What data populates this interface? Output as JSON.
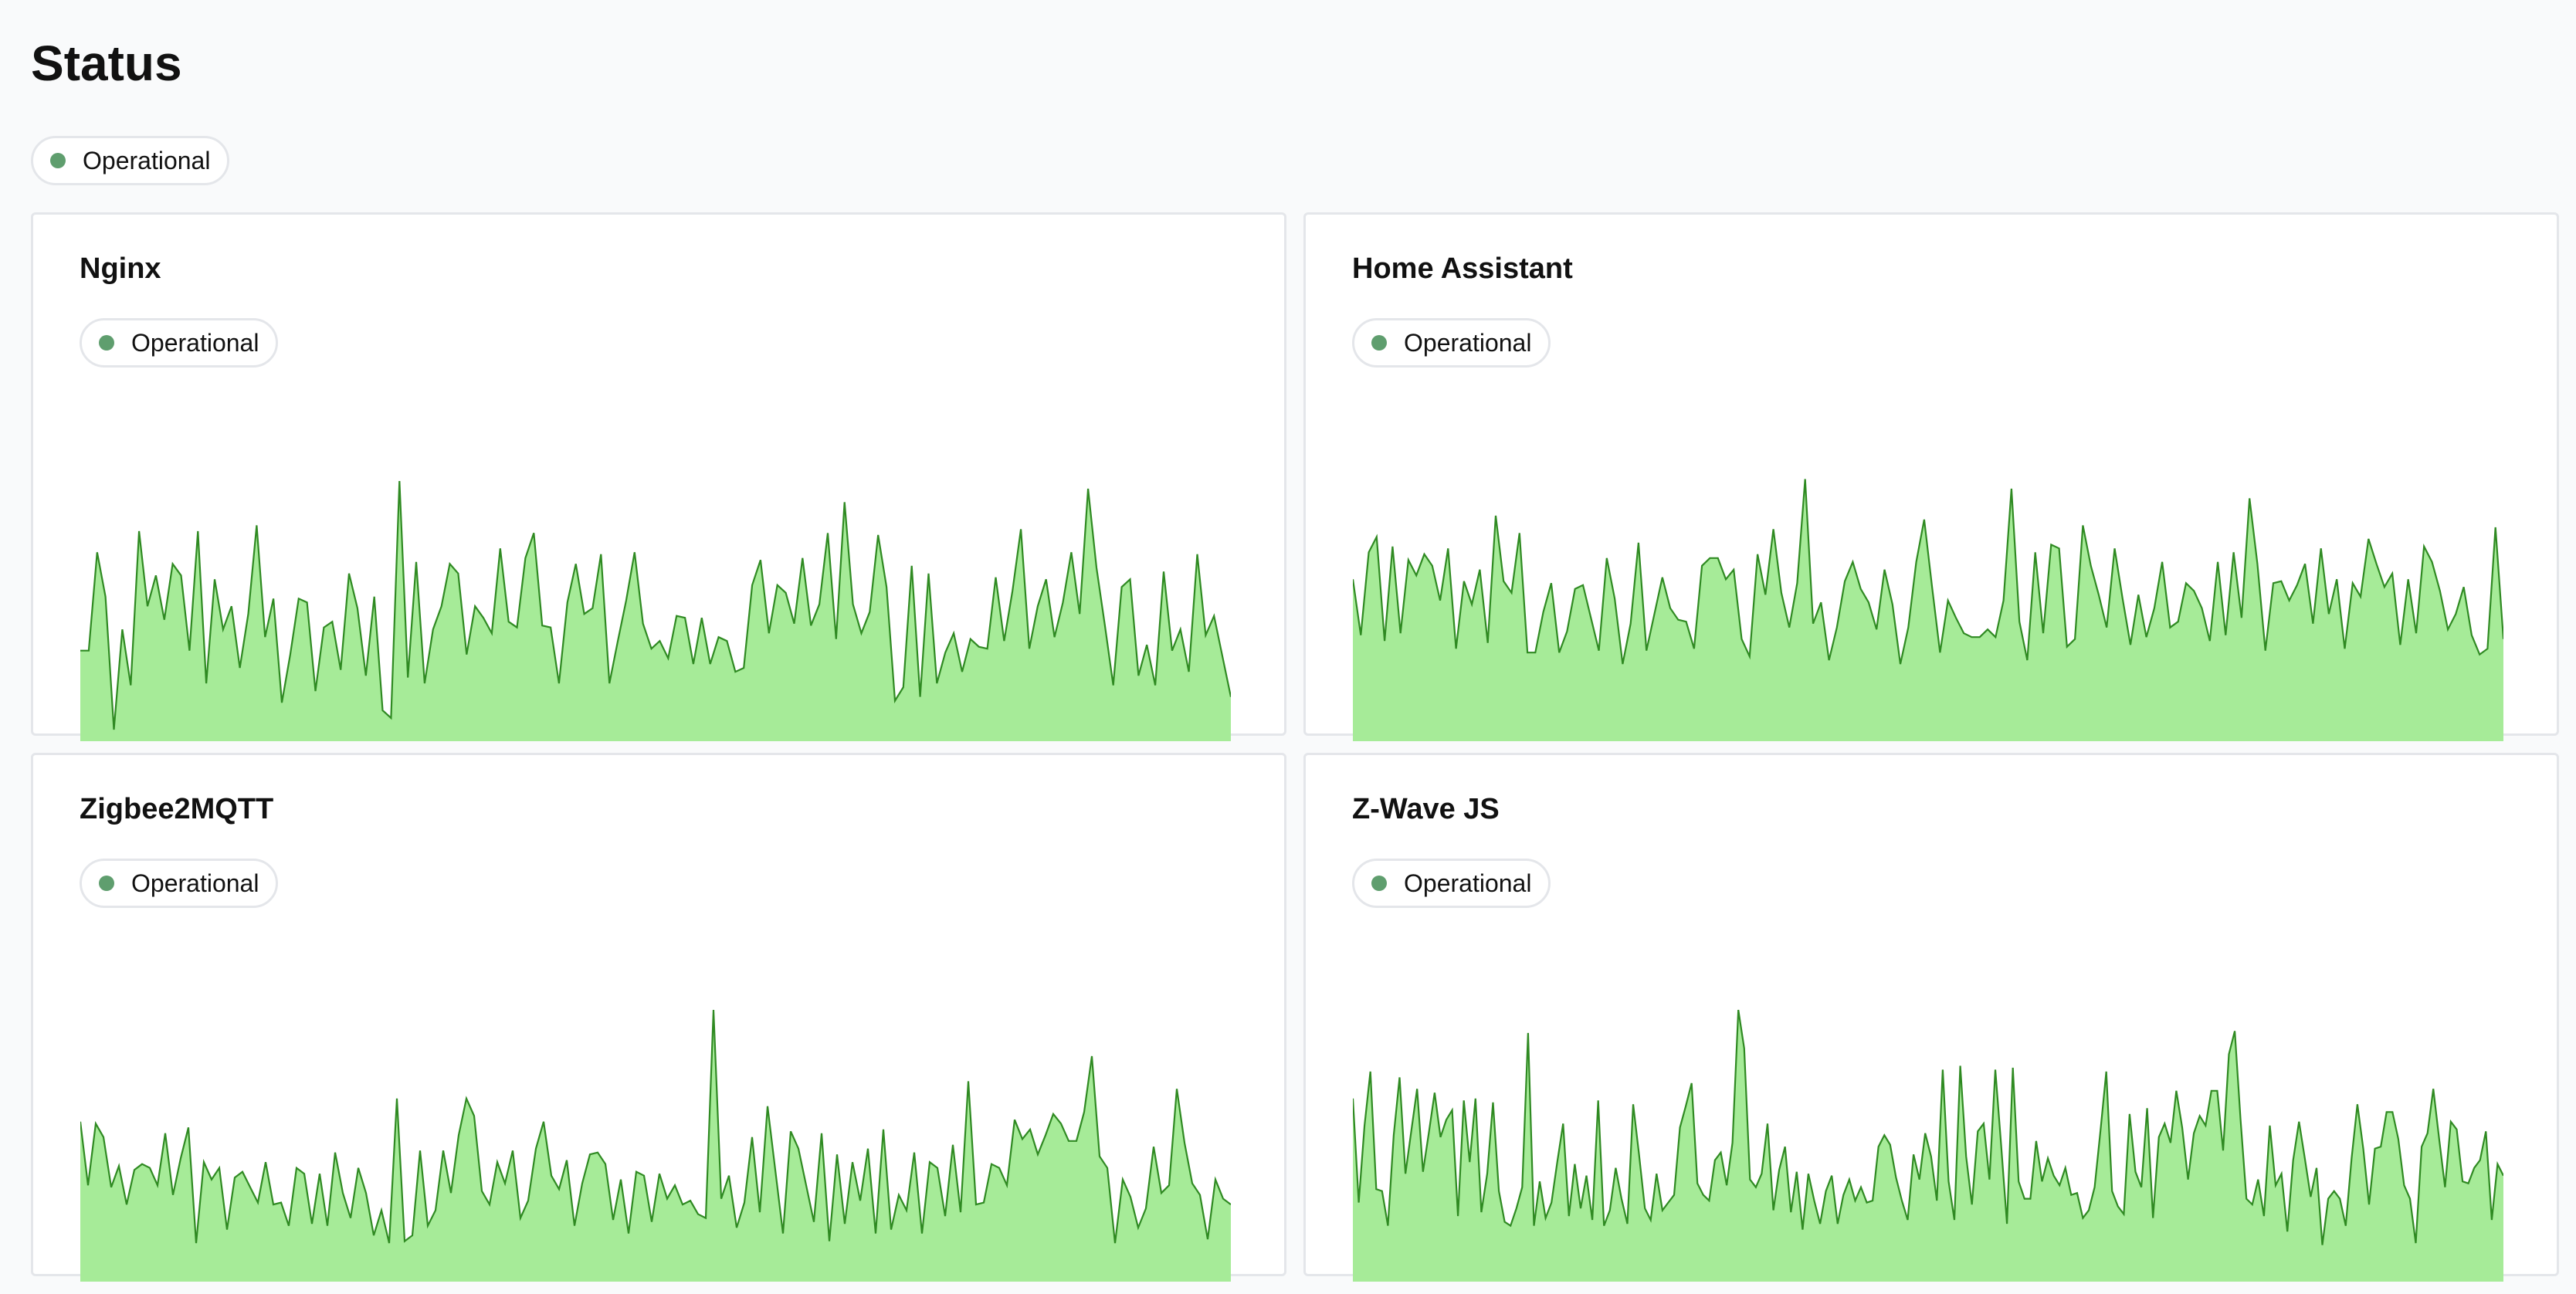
{
  "page": {
    "title": "Status"
  },
  "overall_status": {
    "label": "Operational",
    "color": "#5f9e6e"
  },
  "colors": {
    "fill": "#a6eb98",
    "line": "#2f8a22",
    "status_dot": "#5f9e6e"
  },
  "chart_data": [
    {
      "type": "area",
      "service": "Nginx",
      "status": "Operational",
      "values": [
        47,
        47,
        98,
        75,
        6,
        58,
        29,
        109,
        70,
        86,
        63,
        92,
        86,
        47,
        109,
        30,
        84,
        58,
        70,
        38,
        66,
        112,
        54,
        74,
        20,
        45,
        74,
        72,
        26,
        59,
        62,
        37,
        87,
        69,
        34,
        75,
        16,
        12,
        135,
        33,
        93,
        30,
        58,
        70,
        92,
        87,
        45,
        70,
        64,
        56,
        100,
        62,
        59,
        95,
        108,
        60,
        59,
        30,
        72,
        92,
        66,
        69,
        97,
        30,
        52,
        73,
        98,
        61,
        48,
        52,
        43,
        65,
        64,
        40,
        64,
        40,
        54,
        52,
        36,
        38,
        81,
        94,
        56,
        81,
        77,
        61,
        95,
        60,
        71,
        108,
        53,
        124,
        71,
        56,
        67,
        107,
        80,
        21,
        28,
        91,
        23,
        87,
        30,
        46,
        56,
        36,
        53,
        49,
        48,
        85,
        52,
        78,
        110,
        48,
        70,
        84,
        54,
        72,
        98,
        66,
        131,
        90,
        60,
        29,
        80,
        84,
        34,
        50,
        29,
        88,
        47,
        58,
        36,
        97,
        55,
        65,
        44,
        23
      ],
      "ylim": [
        0,
        140
      ]
    },
    {
      "type": "area",
      "service": "Home Assistant",
      "status": "Operational",
      "values": [
        84,
        55,
        98,
        106,
        52,
        101,
        56,
        94,
        86,
        97,
        91,
        73,
        100,
        48,
        83,
        71,
        89,
        51,
        117,
        83,
        77,
        108,
        46,
        46,
        67,
        82,
        46,
        57,
        79,
        81,
        64,
        47,
        95,
        74,
        40,
        61,
        103,
        47,
        66,
        85,
        69,
        63,
        62,
        48,
        91,
        95,
        95,
        84,
        89,
        53,
        44,
        97,
        76,
        110,
        77,
        59,
        82,
        136,
        61,
        72,
        42,
        59,
        83,
        93,
        79,
        72,
        58,
        89,
        71,
        40,
        59,
        93,
        115,
        80,
        46,
        73,
        64,
        56,
        54,
        54,
        58,
        54,
        73,
        131,
        62,
        42,
        98,
        56,
        102,
        100,
        49,
        53,
        112,
        91,
        76,
        59,
        100,
        74,
        50,
        76,
        54,
        69,
        93,
        59,
        62,
        82,
        78,
        69,
        52,
        93,
        55,
        98,
        64,
        126,
        92,
        47,
        82,
        83,
        73,
        81,
        92,
        61,
        100,
        66,
        84,
        48,
        82,
        75,
        105,
        92,
        80,
        87,
        50,
        84,
        56,
        101,
        93,
        78,
        58,
        66,
        80,
        55,
        45,
        48,
        111,
        53
      ],
      "ylim": [
        0,
        140
      ]
    },
    {
      "type": "area",
      "service": "Zigbee2MQTT",
      "status": "Operational",
      "values": [
        83,
        50,
        82,
        75,
        49,
        60,
        40,
        58,
        61,
        59,
        50,
        77,
        45,
        64,
        80,
        20,
        62,
        53,
        59,
        27,
        54,
        57,
        49,
        41,
        62,
        40,
        41,
        29,
        59,
        56,
        30,
        56,
        29,
        67,
        46,
        33,
        59,
        46,
        24,
        37,
        20,
        95,
        21,
        24,
        68,
        29,
        37,
        68,
        46,
        76,
        95,
        86,
        47,
        40,
        62,
        51,
        68,
        33,
        42,
        69,
        83,
        55,
        48,
        63,
        29,
        51,
        66,
        67,
        61,
        32,
        53,
        25,
        57,
        55,
        31,
        56,
        43,
        50,
        40,
        42,
        35,
        33,
        141,
        43,
        55,
        28,
        41,
        75,
        36,
        91,
        58,
        25,
        78,
        69,
        50,
        31,
        77,
        21,
        66,
        30,
        62,
        42,
        69,
        25,
        79,
        27,
        45,
        37,
        67,
        25,
        62,
        59,
        34,
        71,
        36,
        104,
        40,
        41,
        61,
        59,
        50,
        84,
        74,
        79,
        66,
        76,
        87,
        82,
        73,
        73,
        88,
        117,
        65,
        59,
        20,
        53,
        44,
        28,
        38,
        70,
        46,
        50,
        100,
        72,
        51,
        45,
        22,
        53,
        43,
        40
      ]
    },
    {
      "type": "area",
      "service": "Z-Wave JS",
      "status": "Operational",
      "values": [
        95,
        41,
        81,
        109,
        48,
        47,
        29,
        76,
        106,
        56,
        78,
        100,
        57,
        77,
        98,
        75,
        84,
        89,
        34,
        94,
        62,
        95,
        36,
        56,
        93,
        47,
        31,
        29,
        38,
        49,
        129,
        29,
        52,
        33,
        41,
        62,
        82,
        34,
        61,
        38,
        55,
        32,
        94,
        29,
        37,
        59,
        43,
        30,
        92,
        66,
        38,
        32,
        56,
        37,
        41,
        45,
        80,
        91,
        103,
        51,
        45,
        42,
        63,
        67,
        50,
        72,
        141,
        121,
        53,
        49,
        56,
        82,
        37,
        58,
        70,
        36,
        57,
        27,
        56,
        42,
        30,
        47,
        55,
        30,
        45,
        53,
        42,
        49,
        41,
        42,
        70,
        76,
        71,
        54,
        42,
        32,
        66,
        53,
        77,
        65,
        42,
        110,
        52,
        32,
        112,
        65,
        40,
        78,
        82,
        53,
        110,
        71,
        30,
        111,
        52,
        43,
        43,
        73,
        52,
        64,
        55,
        50,
        59,
        45,
        46,
        33,
        37,
        49,
        78,
        109,
        47,
        39,
        35,
        87,
        57,
        49,
        90,
        33,
        75,
        82,
        72,
        99,
        80,
        53,
        77,
        86,
        81,
        99,
        99,
        68,
        118,
        130,
        84,
        43,
        40,
        53,
        34,
        81,
        50,
        56,
        26,
        63,
        83,
        64,
        44,
        59,
        19,
        43,
        47,
        43,
        29,
        64,
        92,
        69,
        40,
        69,
        70,
        88,
        88,
        74,
        50,
        43,
        20,
        70,
        77,
        100,
        74,
        49,
        83,
        79,
        52,
        51,
        59,
        63,
        78,
        32,
        61,
        55
      ]
    }
  ]
}
